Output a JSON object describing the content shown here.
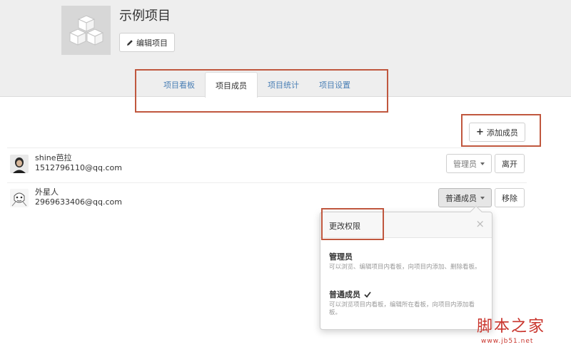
{
  "project": {
    "title": "示例项目",
    "edit_label": "编辑项目"
  },
  "tabs": [
    {
      "label": "项目看板",
      "active": false
    },
    {
      "label": "项目成员",
      "active": true
    },
    {
      "label": "项目统计",
      "active": false
    },
    {
      "label": "项目设置",
      "active": false
    }
  ],
  "toolbar": {
    "add_member_label": "添加成员"
  },
  "members": [
    {
      "name": "shine芭拉",
      "email": "1512796110@qq.com",
      "role": "管理员",
      "action": "离开"
    },
    {
      "name": "外星人",
      "email": "2969633406@qq.com",
      "role": "普通成员",
      "action": "移除"
    }
  ],
  "popover": {
    "title": "更改权限",
    "close": "×",
    "options": [
      {
        "title": "管理员",
        "desc": "可以浏览、编辑项目内看板，向项目内添加、删除看板。",
        "checked": false
      },
      {
        "title": "普通成员",
        "desc": "可以浏览项目内看板，编辑所在看板，向项目内添加看板。",
        "checked": true
      }
    ]
  },
  "watermark": {
    "text": "脚本之家",
    "url": "www.jb51.net"
  },
  "colors": {
    "header_bg": "#eeeeee",
    "link": "#4a7fb5",
    "annotation": "#c0573e",
    "watermark": "#c9342c"
  }
}
